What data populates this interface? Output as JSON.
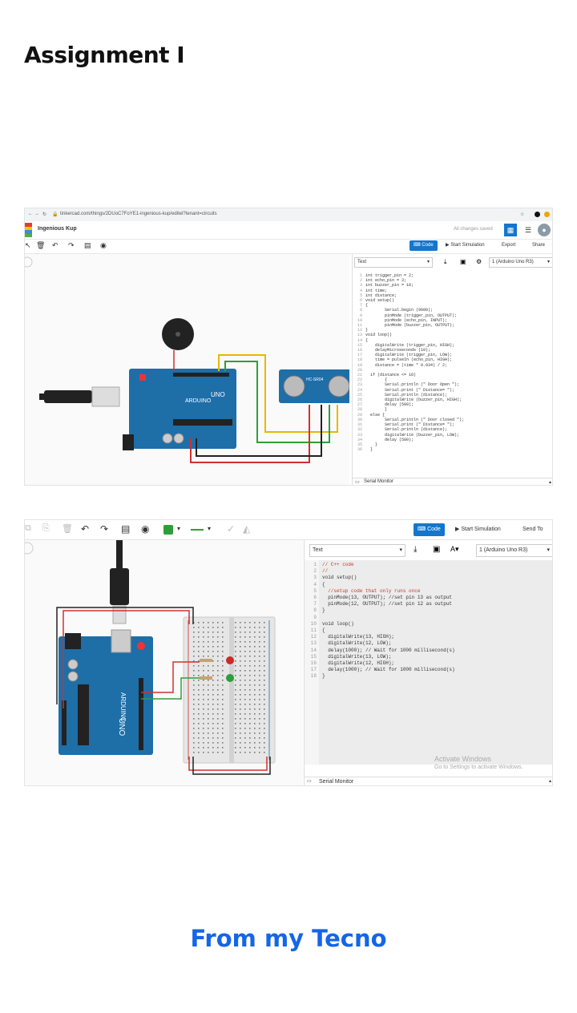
{
  "page": {
    "heading": "Assignment I",
    "footer": "From my Tecno"
  },
  "shot1": {
    "url": "tinkercad.com/things/2DUoC7FoYE1-ingenious-kup/editel?tenant=circuits",
    "project_name": "Ingenious Kup",
    "saved_status": "All changes saved",
    "code_button": "Code",
    "start_simulation": "Start Simulation",
    "export": "Export",
    "share": "Share",
    "mode_select": "Text",
    "board_select": "1 (Arduino Uno R3)",
    "serial_monitor": "Serial Monitor",
    "sensor_label": "HC-SR04",
    "board_brand": "ARDUINO",
    "board_model": "UNO",
    "code_lines": [
      "int trigger_pin = 2;",
      "int echo_pin = 3;",
      "int buzzer_pin = 10;",
      "int time;",
      "int distance;",
      "void setup()",
      "{",
      "        Serial.begin (9600);",
      "        pinMode (trigger_pin, OUTPUT);",
      "        pinMode (echo_pin, INPUT);",
      "        pinMode (buzzer_pin, OUTPUT);",
      "}",
      "void loop()",
      "{",
      "    digitalWrite (trigger_pin, HIGH);",
      "    delayMicroseconds (10);",
      "    digitalWrite (trigger_pin, LOW);",
      "    time = pulseIn (echo_pin, HIGH);",
      "    distance = (time * 0.034) / 2;",
      "",
      "  if (distance <= 10)",
      "        {",
      "        Serial.println (\" Door Open \");",
      "        Serial.print (\" Distance= \");",
      "        Serial.println (distance);",
      "        digitalWrite (buzzer_pin, HIGH);",
      "        delay (500);",
      "        }",
      "  else {",
      "        Serial.println (\" Door closed \");",
      "        Serial.print (\" Distance= \");",
      "        Serial.println (distance);",
      "        digitalWrite (buzzer_pin, LOW);",
      "        delay (500);",
      "    }",
      "  }"
    ]
  },
  "shot2": {
    "code_button": "Code",
    "start_simulation": "Start Simulation",
    "send_to": "Send To",
    "mode_select": "Text",
    "board_select": "1 (Arduino Uno R3)",
    "serial_monitor": "Serial Monitor",
    "activate_title": "Activate Windows",
    "activate_sub": "Go to Settings to activate Windows.",
    "board_brand": "ARDUINO",
    "board_model": "UNO",
    "code_lines": [
      "// C++ code",
      "//",
      "void setup()",
      "{",
      "  //setup code that only runs once",
      "  pinMode(13, OUTPUT); //set pin 13 as output",
      "  pinMode(12, OUTPUT); //set pin 12 as output",
      "}",
      "",
      "void loop()",
      "{",
      "  digitalWrite(13, HIGH);",
      "  digitalWrite(12, LOW);",
      "  delay(1000); // Wait for 1000 millisecond(s)",
      "  digitalWrite(13, LOW);",
      "  digitalWrite(12, HIGH);",
      "  delay(1000); // Wait for 1000 millisecond(s)",
      "}"
    ]
  },
  "colors": {
    "footer": "#1565e8",
    "board": "#1e6ea8",
    "accent": "#1476cc",
    "wire_red": "#d32f2f",
    "wire_green": "#2e9e3a",
    "wire_yellow": "#e6b800"
  }
}
